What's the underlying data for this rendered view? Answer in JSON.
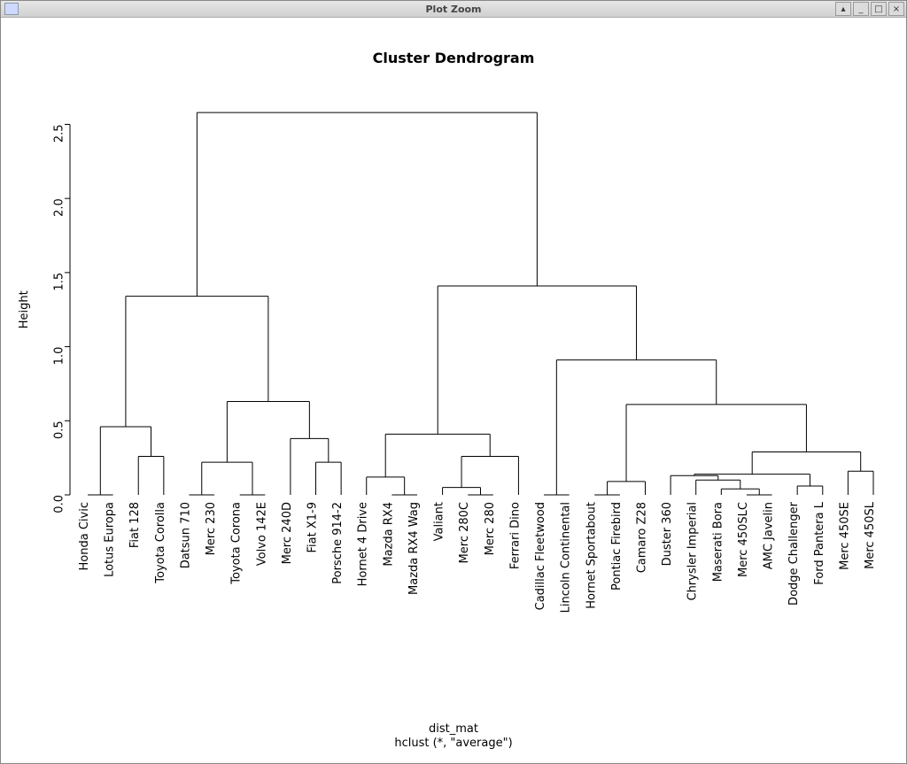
{
  "window": {
    "title": "Plot Zoom"
  },
  "chart_data": {
    "type": "dendrogram",
    "title": "Cluster Dendrogram",
    "ylabel": "Height",
    "xlabel_main": "dist_mat",
    "xlabel_sub": "hclust (*, \"average\")",
    "yticks": [
      0.0,
      0.5,
      1.0,
      1.5,
      2.0,
      2.5
    ],
    "ylim": [
      0.0,
      2.7
    ],
    "leaves": [
      "Honda Civic",
      "Lotus Europa",
      "Fiat 128",
      "Toyota Corolla",
      "Datsun 710",
      "Merc 230",
      "Toyota Corona",
      "Volvo 142E",
      "Merc 240D",
      "Fiat X1-9",
      "Porsche 914-2",
      "Hornet 4 Drive",
      "Mazda RX4",
      "Mazda RX4 Wag",
      "Valiant",
      "Merc 280C",
      "Merc 280",
      "Ferrari Dino",
      "Cadillac Fleetwood",
      "Lincoln Continental",
      "Hornet Sportabout",
      "Pontiac Firebird",
      "Camaro Z28",
      "Duster 360",
      "Chrysler Imperial",
      "Maserati Bora",
      "Merc 450SLC",
      "AMC Javelin",
      "Dodge Challenger",
      "Ford Pantera L",
      "Merc 450SE",
      "Merc 450SL"
    ],
    "merges": [
      {
        "id": "m1",
        "left": "Honda Civic",
        "right": "Lotus Europa",
        "h": 0.0
      },
      {
        "id": "m2",
        "left": "Fiat 128",
        "right": "Toyota Corolla",
        "h": 0.26
      },
      {
        "id": "m3",
        "left": "m1",
        "right": "m2",
        "h": 0.46
      },
      {
        "id": "m4",
        "left": "Datsun 710",
        "right": "Merc 230",
        "h": 0.0
      },
      {
        "id": "m5",
        "left": "Toyota Corona",
        "right": "Volvo 142E",
        "h": 0.0
      },
      {
        "id": "m6",
        "left": "m4",
        "right": "m5",
        "h": 0.22
      },
      {
        "id": "m7",
        "left": "Fiat X1-9",
        "right": "Porsche 914-2",
        "h": 0.22
      },
      {
        "id": "m8",
        "left": "Merc 240D",
        "right": "m7",
        "h": 0.38
      },
      {
        "id": "m9",
        "left": "m6",
        "right": "m8",
        "h": 0.63
      },
      {
        "id": "m10",
        "left": "m3",
        "right": "m9",
        "h": 1.34
      },
      {
        "id": "m11",
        "left": "Mazda RX4",
        "right": "Mazda RX4 Wag",
        "h": 0.0
      },
      {
        "id": "m12",
        "left": "Hornet 4 Drive",
        "right": "m11",
        "h": 0.12
      },
      {
        "id": "m13",
        "left": "Merc 280C",
        "right": "Merc 280",
        "h": 0.0
      },
      {
        "id": "m14",
        "left": "Valiant",
        "right": "m13",
        "h": 0.05
      },
      {
        "id": "m15",
        "left": "m14",
        "right": "Ferrari Dino",
        "h": 0.26
      },
      {
        "id": "m16",
        "left": "m12",
        "right": "m15",
        "h": 0.41
      },
      {
        "id": "m17",
        "left": "Cadillac Fleetwood",
        "right": "Lincoln Continental",
        "h": 0.0
      },
      {
        "id": "m18",
        "left": "Hornet Sportabout",
        "right": "Pontiac Firebird",
        "h": 0.0
      },
      {
        "id": "m19",
        "left": "m18",
        "right": "Camaro Z28",
        "h": 0.09
      },
      {
        "id": "m20",
        "left": "Merc 450SLC",
        "right": "AMC Javelin",
        "h": 0.0
      },
      {
        "id": "m21",
        "left": "Maserati Bora",
        "right": "m20",
        "h": 0.04
      },
      {
        "id": "m22",
        "left": "Chrysler Imperial",
        "right": "m21",
        "h": 0.1
      },
      {
        "id": "m23",
        "left": "Duster 360",
        "right": "m22",
        "h": 0.13
      },
      {
        "id": "m24",
        "left": "Dodge Challenger",
        "right": "Ford Pantera L",
        "h": 0.06
      },
      {
        "id": "m25",
        "left": "m23",
        "right": "m24",
        "h": 0.14
      },
      {
        "id": "m26",
        "left": "Merc 450SE",
        "right": "Merc 450SL",
        "h": 0.0
      },
      {
        "id": "m27",
        "left": "m26",
        "right": "m25",
        "h": 0.0,
        "ghost": true
      },
      {
        "id": "m25b",
        "left": "m25",
        "right": "m26r",
        "h": 0.0,
        "ghost": true
      },
      {
        "id": "m28",
        "left": "m25",
        "right": "m26",
        "h_left": 0.14,
        "h_right": 0.16,
        "h": 0.29,
        "type": "asym"
      },
      {
        "id": "m29",
        "left": "m28",
        "right_dummy": null,
        "h": 0.37,
        "ghost": true
      },
      {
        "id": "m30",
        "left": "m19",
        "right": "m28_wrap",
        "h": 0.0,
        "ghost": true
      },
      {
        "id": "m28w",
        "left": "m25",
        "right": "m26",
        "h": 0.29
      },
      {
        "id": "m28x",
        "left": "m28w",
        "right": null,
        "h": 0.0,
        "ghost": true
      },
      {
        "id": "m_inner1",
        "left": "m25",
        "right": "m26",
        "h": 0.29,
        "real": true
      },
      {
        "id": "m_inner2",
        "left": "m19",
        "right": "m_inner1_wrap",
        "h": 0.0,
        "ghost": true
      }
    ]
  }
}
